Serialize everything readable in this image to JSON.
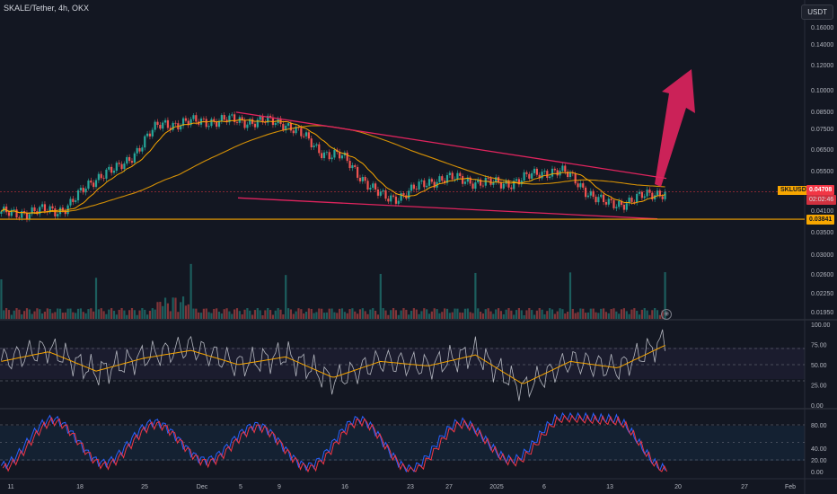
{
  "header": {
    "symbol": "SKALE/Tether, 4h, OKX",
    "currency": "USDT"
  },
  "price_tags": {
    "symbol_chip": "SKLUSDT",
    "last_price": "0.04708",
    "countdown": "02:02:46",
    "support_level": "0.03841"
  },
  "colors": {
    "up": "#26a69a",
    "down": "#ef5350",
    "ma_fast": "#f7a600",
    "ma_slow": "#f7a600",
    "trendline": "#e0245e",
    "arrow": "#e0245e",
    "rsi": "#b2b5be",
    "rsi_ma": "#f7a600",
    "stoch_k": "#2962ff",
    "stoch_d": "#f23645"
  },
  "chart_data": [
    {
      "type": "line",
      "title": "SKALE/Tether, 4h, OKX",
      "x_ticks": [
        "11",
        "18",
        "25",
        "Dec",
        "5",
        "9",
        "16",
        "23",
        "27",
        "2025",
        "6",
        "13",
        "20",
        "27",
        "Feb"
      ],
      "y_ticks": [
        "0.16000",
        "0.14000",
        "0.12000",
        "0.10000",
        "0.08500",
        "0.07500",
        "0.06500",
        "0.05500",
        "0.04100",
        "0.03500",
        "0.03000",
        "0.02600",
        "0.02250",
        "0.01950"
      ],
      "scale": "log",
      "series": [
        {
          "name": "",
          "x": [
            "11",
            "18",
            "25",
            "Dec",
            "5",
            "9",
            "16",
            "23",
            "27",
            "2025",
            "6",
            "13",
            "20"
          ],
          "values": [
            0.04,
            0.041,
            0.055,
            0.078,
            0.08,
            0.079,
            0.062,
            0.045,
            0.052,
            0.05,
            0.055,
            0.043,
            0.047
          ]
        }
      ],
      "annotations": {
        "support_level": 0.03841,
        "last_price": 0.04708,
        "projection_target": 0.117
      }
    },
    {
      "type": "line",
      "ylim": [
        0,
        100
      ],
      "y_ticks": [
        "100.00",
        "75.00",
        "50.00",
        "25.00",
        "0.00"
      ],
      "series": [
        {
          "name": "",
          "values": [
            55,
            70,
            40,
            60,
            72,
            50,
            62,
            30,
            55,
            48,
            65,
            20,
            55,
            45,
            80
          ]
        }
      ]
    },
    {
      "type": "line",
      "ylim": [
        0,
        100
      ],
      "y_ticks": [
        "80.00",
        "40.00",
        "20.00",
        "0.00"
      ],
      "series": [
        {
          "name": "",
          "values": [
            10,
            90,
            15,
            85,
            20,
            80,
            10,
            90,
            5,
            85,
            20,
            95,
            90,
            5
          ]
        }
      ]
    }
  ]
}
